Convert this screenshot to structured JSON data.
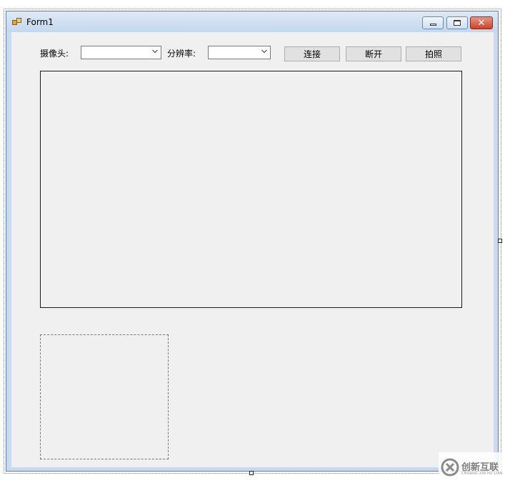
{
  "window": {
    "title": "Form1"
  },
  "toolbar": {
    "camera_label": "摄像头:",
    "camera_value": "",
    "resolution_label": "分辨率:",
    "resolution_value": "",
    "connect_label": "连接",
    "disconnect_label": "断开",
    "capture_label": "拍照"
  },
  "icons": {
    "app": "form-app-icon",
    "minimize": "minimize-icon",
    "maximize": "maximize-icon",
    "close": "close-icon",
    "dropdown": "chevron-down-icon"
  },
  "colors": {
    "titlebar": "#c4d8ed",
    "client": "#f0f0f0",
    "close_button": "#c9452b"
  },
  "watermark": {
    "main": "创新互联",
    "sub": "CHUANG XIN HU LIAN"
  }
}
